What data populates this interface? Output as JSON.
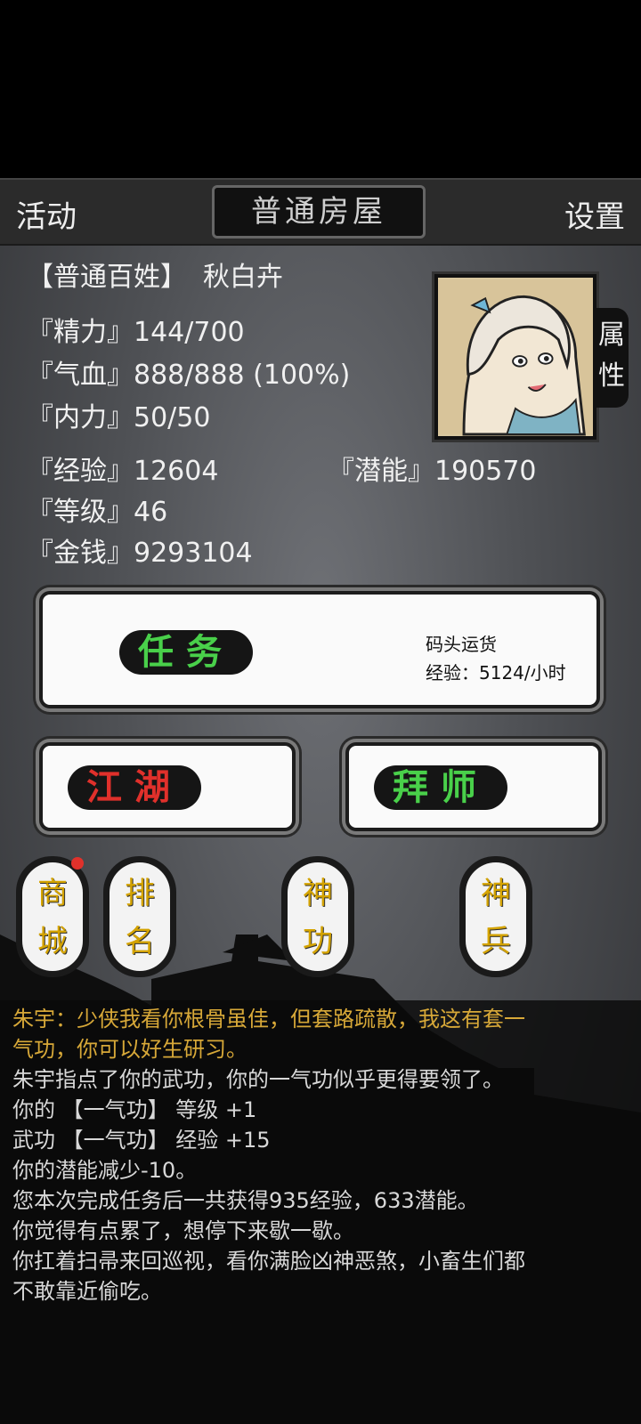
{
  "header": {
    "left_button": "活动",
    "title": "普通房屋",
    "right_button": "设置"
  },
  "profile": {
    "rank": "【普通百姓】",
    "name": "秋白卉",
    "attr_tab": [
      "属",
      "性"
    ]
  },
  "stats": {
    "jingli": "『精力』144/700",
    "qixue": "『气血』888/888 (100%)",
    "neili": "『内力』50/50",
    "jingyan": "『经验』12604",
    "qianneng": "『潜能』190570",
    "dengji": "『等级』46",
    "jinqian": "『金钱』9293104"
  },
  "task": {
    "label": "任务",
    "name": "码头运货",
    "exp": "经验：5124/小时"
  },
  "buttons": {
    "jianghu": "江湖",
    "baishi": "拜师"
  },
  "scrolls": [
    {
      "top": "商",
      "bottom": "城"
    },
    {
      "top": "排",
      "bottom": "名"
    },
    {
      "top": "神",
      "bottom": "功"
    },
    {
      "top": "神",
      "bottom": "兵"
    }
  ],
  "log": [
    {
      "text": "朱宇：少侠我看你根骨虽佳，但套路疏散，我这有套一",
      "style": "hl"
    },
    {
      "text": "气功，你可以好生研习。",
      "style": "hl"
    },
    {
      "text": "朱宇指点了你的武功，你的一气功似乎更得要领了。",
      "style": "normal"
    },
    {
      "text": "你的 【一气功】 等级 +1",
      "style": "normal"
    },
    {
      "text": "武功 【一气功】 经验 +15",
      "style": "normal"
    },
    {
      "text": "你的潜能减少-10。",
      "style": "normal"
    },
    {
      "text": "您本次完成任务后一共获得935经验，633潜能。",
      "style": "normal"
    },
    {
      "text": "你觉得有点累了，想停下来歇一歇。",
      "style": "normal"
    },
    {
      "text": "你扛着扫帚来回巡视，看你满脸凶神恶煞，小畜生们都",
      "style": "normal"
    },
    {
      "text": "不敢靠近偷吃。",
      "style": "normal"
    }
  ],
  "colors": {
    "task_label": "#49d04a",
    "jianghu_label": "#e0302b",
    "baishi_label": "#49d04a",
    "scroll_text": "#d4a300",
    "log_highlight": "#d7a838",
    "notification_dot": "#e0312b"
  }
}
